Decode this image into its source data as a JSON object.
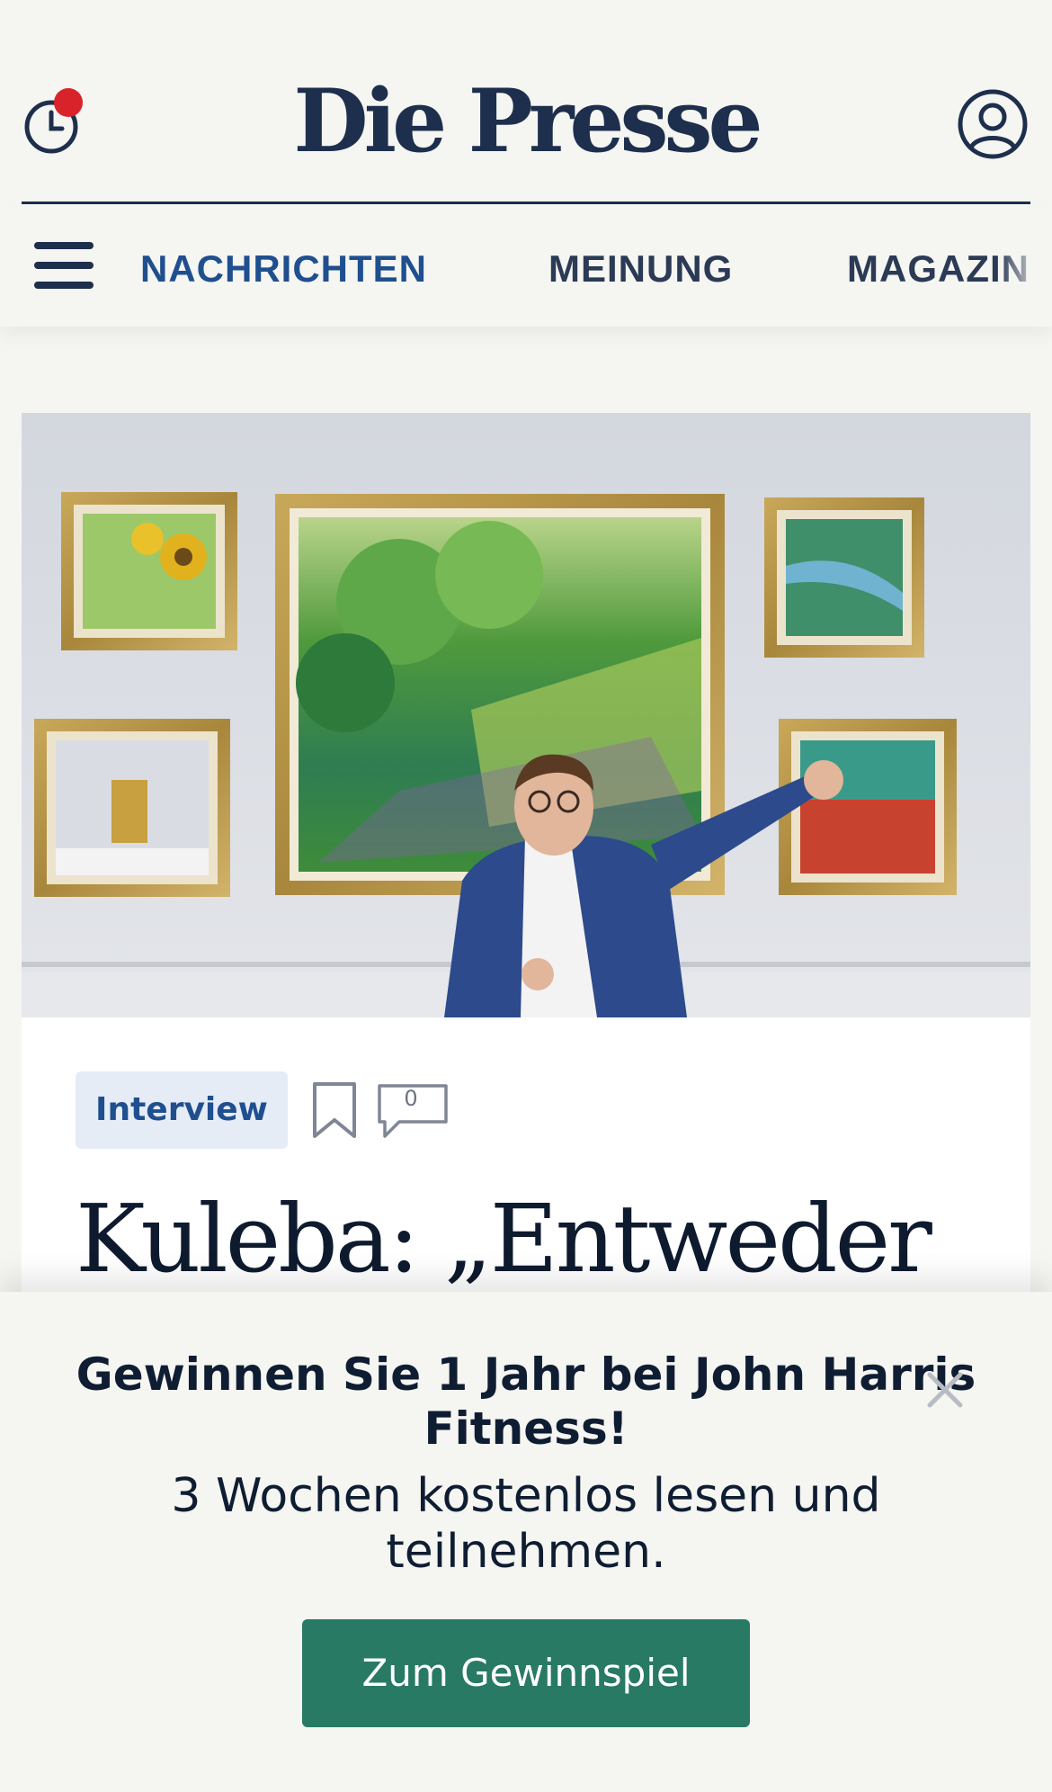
{
  "header": {
    "logo": "Die Presse",
    "history_icon": "clock-icon",
    "account_icon": "user-circle-icon",
    "notification": true
  },
  "nav": {
    "menu_icon": "hamburger-icon",
    "items": [
      {
        "label": "NACHRICHTEN",
        "active": true
      },
      {
        "label": "MEINUNG",
        "active": false
      },
      {
        "label": "MAGAZIN",
        "active": false
      }
    ]
  },
  "article": {
    "tag": "Interview",
    "bookmark_icon": "bookmark-icon",
    "comment_icon": "comment-icon",
    "comment_count": "0",
    "headline": "Kuleba: „Entweder"
  },
  "promo": {
    "title": "Gewinnen Sie 1 Jahr bei John Harris Fitness!",
    "subtitle": "3 Wochen kostenlos lesen und teilnehmen.",
    "cta_label": "Zum Gewinnspiel",
    "close_icon": "close-icon"
  },
  "colors": {
    "brand_navy": "#1e2f4d",
    "nav_active": "#1f4f8f",
    "notification_dot": "#d8232a",
    "cta_green": "#287a64",
    "tag_bg": "#e6ecf5"
  }
}
